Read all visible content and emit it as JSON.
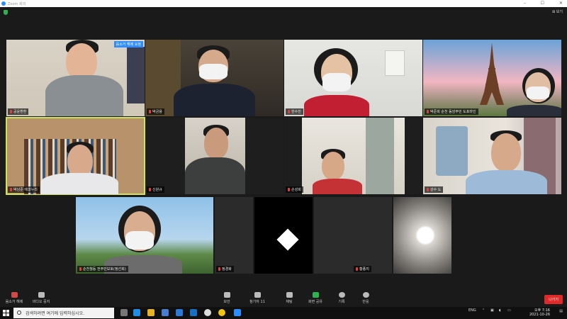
{
  "window": {
    "title": "Zoom 회의",
    "controls": [
      "–",
      "☐",
      "✕"
    ]
  },
  "top": {
    "view_label": "⊞ 보기"
  },
  "participants": [
    {
      "name": "공윤환환",
      "badge": "음소거 해제 요청"
    },
    {
      "name": "박금용"
    },
    {
      "name": "한수진"
    },
    {
      "name": "박준희 순천 동암주민 도포마인"
    },
    {
      "name": "박남준 에코누리"
    },
    {
      "name": "신원규"
    },
    {
      "name": "손성희"
    },
    {
      "name": "강수 도"
    },
    {
      "name": "순천월등 전주민보호(정선희)"
    },
    {
      "name": "정경화"
    },
    {
      "name": ""
    },
    {
      "name": "황종지"
    }
  ],
  "toolbar": {
    "items": [
      {
        "label": "음소거 해제"
      },
      {
        "label": "비디오 중지"
      },
      {
        "label": "보안"
      },
      {
        "label": "참가자",
        "count": "11"
      },
      {
        "label": "채팅"
      },
      {
        "label": "화면 공유"
      },
      {
        "label": "기록"
      },
      {
        "label": "반응"
      }
    ],
    "leave_label": "나가기"
  },
  "taskbar": {
    "search_placeholder": "검색하려면 여기에 입력하십시오.",
    "tray_lang": "ENG",
    "time": "오후 7:16",
    "date": "2021-10-26"
  },
  "colors": {
    "zoom_blue": "#2d8cff",
    "active_border": "#cfe35a",
    "leave_red": "#e02a2a",
    "share_green": "#2fb150"
  }
}
